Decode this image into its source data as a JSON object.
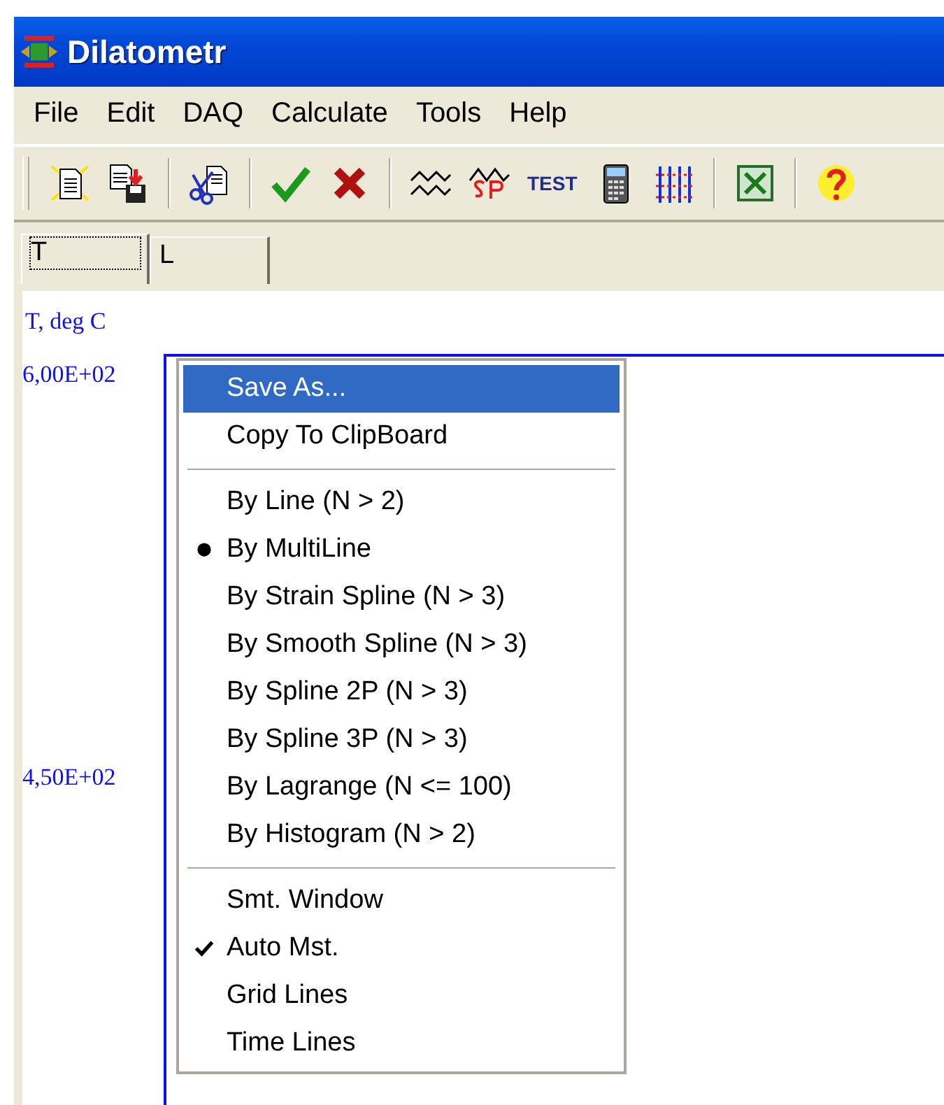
{
  "window": {
    "title": "Dilatometr"
  },
  "menu_bar": [
    "File",
    "Edit",
    "DAQ",
    "Calculate",
    "Tools",
    "Help"
  ],
  "toolbar": {
    "text_button": "TEST"
  },
  "tabs": [
    {
      "label": "T",
      "selected": true
    },
    {
      "label": "L",
      "selected": false
    }
  ],
  "plot": {
    "axis_label": "T, deg C",
    "y_tick_labels": [
      "6,00E+02",
      "4,50E+02"
    ]
  },
  "context_menu": {
    "sections": [
      {
        "kind": "commands",
        "items": [
          {
            "label": "Save As...",
            "highlighted": true
          },
          {
            "label": "Copy To ClipBoard",
            "highlighted": false
          }
        ]
      },
      {
        "kind": "radio",
        "items": [
          {
            "label": "By Line (N > 2)",
            "selected": false
          },
          {
            "label": "By MultiLine",
            "selected": true
          },
          {
            "label": "By Strain Spline (N > 3)",
            "selected": false
          },
          {
            "label": "By Smooth Spline (N > 3)",
            "selected": false
          },
          {
            "label": "By Spline 2P (N > 3)",
            "selected": false
          },
          {
            "label": "By Spline 3P (N > 3)",
            "selected": false
          },
          {
            "label": "By Lagrange (N <= 100)",
            "selected": false
          },
          {
            "label": "By Histogram (N > 2)",
            "selected": false
          }
        ]
      },
      {
        "kind": "toggles",
        "items": [
          {
            "label": "Smt. Window",
            "checked": false
          },
          {
            "label": "Auto Mst.",
            "checked": true
          },
          {
            "label": "Grid Lines",
            "checked": false
          },
          {
            "label": "Time Lines",
            "checked": false
          }
        ]
      }
    ]
  }
}
